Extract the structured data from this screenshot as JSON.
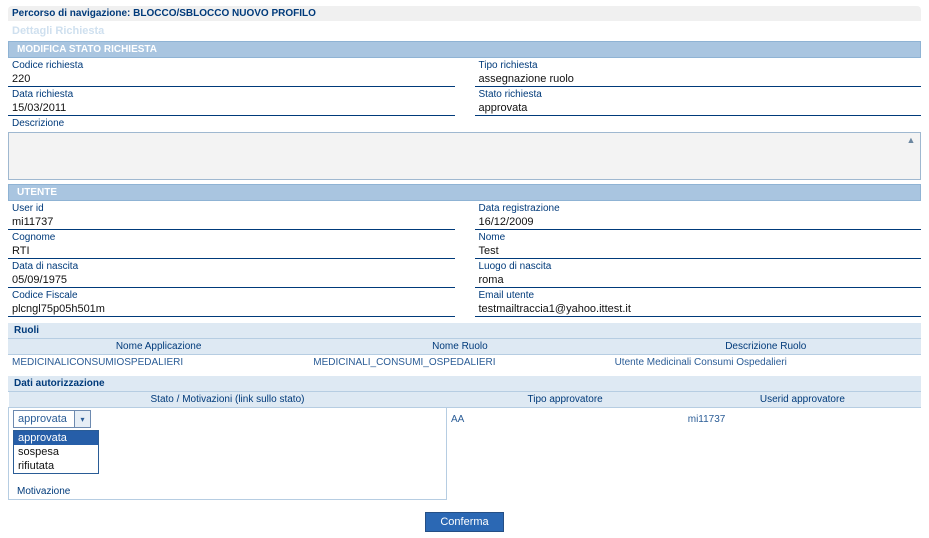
{
  "breadcrumb": {
    "prefix": "Percorso di navigazione:",
    "path": "BLOCCO/SBLOCCO NUOVO PROFILO"
  },
  "page_title": "Dettagli Richiesta",
  "sections": {
    "modifica": "MODIFICA STATO RICHIESTA",
    "utente": "UTENTE"
  },
  "request": {
    "codice_label": "Codice richiesta",
    "codice": "220",
    "tipo_label": "Tipo richiesta",
    "tipo": "assegnazione ruolo",
    "data_label": "Data richiesta",
    "data": "15/03/2011",
    "stato_label": "Stato richiesta",
    "stato": "approvata",
    "descrizione_label": "Descrizione"
  },
  "user": {
    "userid_label": "User id",
    "userid": "mi11737",
    "datareg_label": "Data registrazione",
    "datareg": "16/12/2009",
    "cognome_label": "Cognome",
    "cognome": "RTI",
    "nome_label": "Nome",
    "nome": "Test",
    "dnascita_label": "Data di nascita",
    "dnascita": "05/09/1975",
    "lnascita_label": "Luogo di nascita",
    "lnascita": "roma",
    "cf_label": "Codice Fiscale",
    "cf": "plcngl75p05h501m",
    "email_label": "Email utente",
    "email": "testmailtraccia1@yahoo.ittest.it"
  },
  "ruoli": {
    "title": "Ruoli",
    "headers": {
      "appl": "Nome Applicazione",
      "ruolo": "Nome Ruolo",
      "descr": "Descrizione Ruolo"
    },
    "row": {
      "appl": "MEDICINALICONSUMIOSPEDALIERI",
      "ruolo": "MEDICINALI_CONSUMI_OSPEDALIERI",
      "descr": "Utente Medicinali Consumi Ospedalieri"
    }
  },
  "auth": {
    "title": "Dati autorizzazione",
    "headers": {
      "stato": "Stato / Motivazioni (link sullo stato)",
      "tipo": "Tipo approvatore",
      "userid": "Userid approvatore"
    },
    "row": {
      "tipo": "AA",
      "userid": "mi11737"
    },
    "motivazione_label": "Motivazione"
  },
  "status_select": {
    "current": "approvata",
    "options": {
      "o1": "approvata",
      "o2": "sospesa",
      "o3": "rifiutata"
    }
  },
  "buttons": {
    "confirm": "Conferma"
  }
}
